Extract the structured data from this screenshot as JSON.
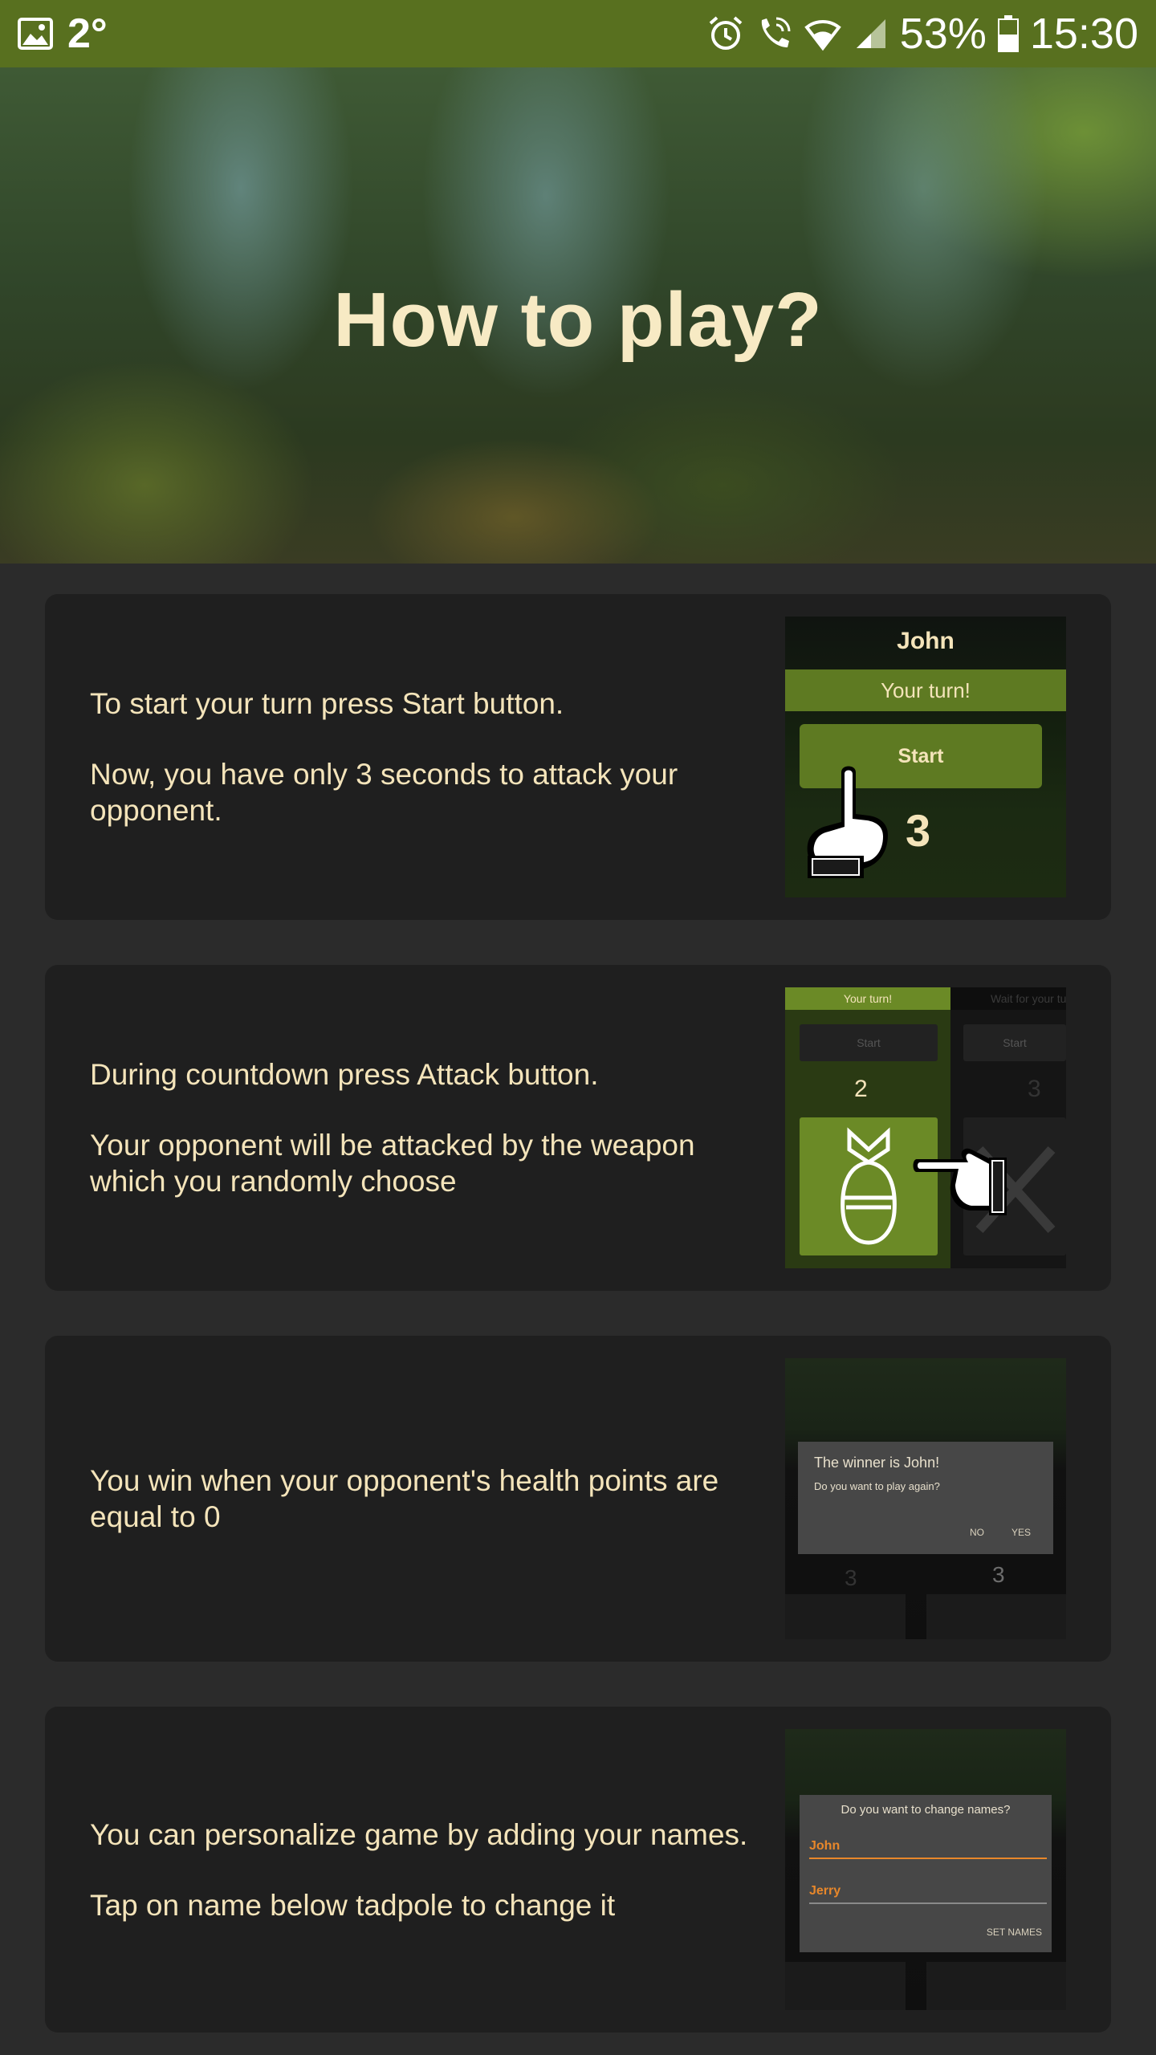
{
  "status_bar": {
    "temperature": "2°",
    "battery_percent": "53%",
    "time": "15:30",
    "icons": [
      "image-icon",
      "alarm-icon",
      "wifi-call-icon",
      "wifi-icon",
      "signal-icon",
      "battery-icon"
    ]
  },
  "hero": {
    "title": "How to play?"
  },
  "cards": [
    {
      "paragraphs": [
        "To start your turn press Start button.",
        "Now, you have only 3 seconds to attack your opponent."
      ],
      "thumb": {
        "player_name": "John",
        "turn_label": "Your turn!",
        "button_label": "Start",
        "countdown": "3"
      }
    },
    {
      "paragraphs": [
        "During countdown press Attack button.",
        "Your opponent will be attacked by the weapon which you randomly choose"
      ],
      "thumb": {
        "turn_label": "Your turn!",
        "wait_label": "Wait for your tu",
        "start_left": "Start",
        "start_right": "Start",
        "countdown_left": "2",
        "countdown_right": "3"
      }
    },
    {
      "paragraphs": [
        "You win when your opponent's health points are equal to 0"
      ],
      "thumb": {
        "dialog_title": "The winner is John!",
        "dialog_question": "Do you want to play again?",
        "no_label": "NO",
        "yes_label": "YES",
        "countdown_left": "3",
        "countdown_right": "3"
      }
    },
    {
      "paragraphs": [
        "You can personalize game by adding your names.",
        "Tap on name below tadpole to change it"
      ],
      "thumb": {
        "dialog_title": "Do you want to change names?",
        "name1": "John",
        "name2": "Jerry",
        "set_label": "SET NAMES"
      }
    }
  ],
  "colors": {
    "status_bar": "#58701f",
    "accent_green": "#5e7a22",
    "card_bg": "#1f1f1f",
    "page_bg": "#2b2b2b",
    "text_cream": "#f4e4ba",
    "title_cream": "#f8eac2",
    "input_orange": "#e8872a"
  }
}
